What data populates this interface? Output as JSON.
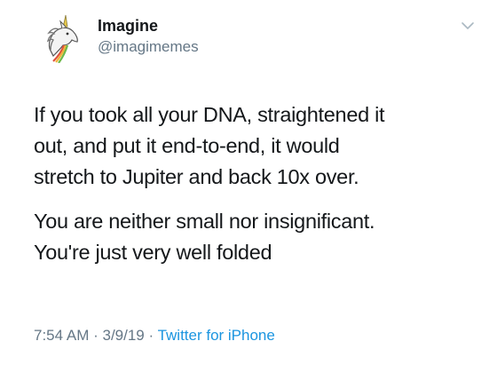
{
  "tweet": {
    "author": {
      "display_name": "Imagine",
      "handle": "@imagimemes",
      "avatar_icon": "unicorn-icon"
    },
    "paragraphs": [
      "If you took all your DNA, straightened it\nout, and put it end-to-end, it would\nstretch to Jupiter and back 10x over.",
      "You are neither small nor insignificant.\nYou're just very well folded"
    ],
    "meta": {
      "time": "7:54 AM",
      "separator_1": " · ",
      "date": "3/9/19",
      "separator_2": " · ",
      "source": "Twitter for iPhone"
    },
    "menu_icon": "chevron-down-icon"
  },
  "colors": {
    "text": "#14171a",
    "secondary": "#657786",
    "link": "#1b95e0"
  }
}
